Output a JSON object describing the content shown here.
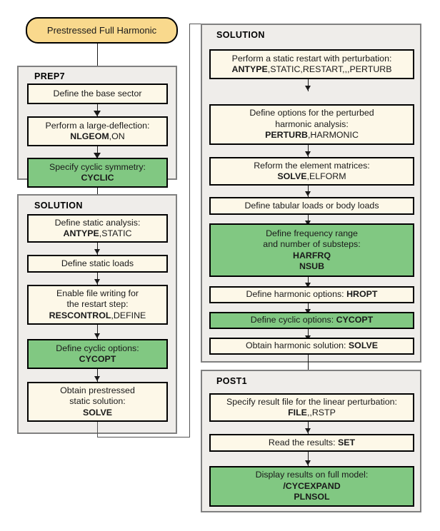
{
  "diagram": {
    "title": "Prestressed Full Harmonic",
    "colors": {
      "start_fill": "#f9d98d",
      "node_fill": "#fdf8e8",
      "highlight_fill": "#81c882",
      "group_fill": "#efedea",
      "group_border": "#808080",
      "node_border": "#000000",
      "connector": "#1a1a1a"
    },
    "start": {
      "label": "Prestressed Full Harmonic"
    },
    "groups": [
      {
        "id": "prep7",
        "title": "PREP7",
        "nodes": [
          {
            "id": "define-base-sector",
            "line1": "Define the base sector",
            "line1_bold": "",
            "line1_tail": "",
            "highlight": false
          },
          {
            "id": "nlgeom",
            "line1": "Perform a large-deflection:",
            "line2_bold": "NLGEOM",
            "line2_tail": ",ON",
            "highlight": false
          },
          {
            "id": "cyclic",
            "line1": "Specify cyclic symmetry:",
            "line2_bold": "CYCLIC",
            "line2_tail": "",
            "highlight": true
          }
        ]
      },
      {
        "id": "solution-left",
        "title": "SOLUTION",
        "nodes": [
          {
            "id": "antype-static",
            "line1": "Define static analysis:",
            "line2_bold": "ANTYPE",
            "line2_tail": ",STATIC",
            "highlight": false
          },
          {
            "id": "define-static-loads",
            "line1": "Define static loads",
            "highlight": false
          },
          {
            "id": "rescontrol",
            "line1": "Enable file writing for",
            "line2": "the restart step:",
            "line3_bold": "RESCONTROL",
            "line3_tail": ",DEFINE",
            "highlight": false
          },
          {
            "id": "cycopt-left",
            "line1": "Define cyclic options:",
            "line2_bold": "CYCOPT",
            "line2_tail": "",
            "highlight": true
          },
          {
            "id": "solve-static",
            "line1": "Obtain prestressed",
            "line2": "static solution:",
            "line3_bold": "SOLVE",
            "line3_tail": "",
            "highlight": false
          }
        ]
      },
      {
        "id": "solution-right",
        "title": "SOLUTION",
        "nodes": [
          {
            "id": "antype-restart-perturb",
            "line1": "Perform a static restart with perturbation:",
            "line2_bold": "ANTYPE",
            "line2_tail": ",STATIC,RESTART,,,PERTURB",
            "highlight": false
          },
          {
            "id": "perturb-harmonic",
            "line1": "Define options for the perturbed",
            "line2": "harmonic analysis:",
            "line3_bold": "PERTURB",
            "line3_tail": ",HARMONIC",
            "highlight": false
          },
          {
            "id": "solve-elform",
            "line1": "Reform the element matrices:",
            "line2_bold": "SOLVE",
            "line2_tail": ",ELFORM",
            "highlight": false
          },
          {
            "id": "tabular-loads",
            "line1": "Define tabular loads or body loads",
            "highlight": false
          },
          {
            "id": "harfrq-nsub",
            "line1": "Define frequency range",
            "line2": "and number of substeps:",
            "line3_bold": "HARFRQ",
            "line4_bold": "NSUB",
            "highlight": true
          },
          {
            "id": "hropt",
            "inline_prefix": "Define harmonic options: ",
            "inline_bold": "HROPT",
            "highlight": false
          },
          {
            "id": "cycopt-right",
            "inline_prefix": "Define cyclic options: ",
            "inline_bold": "CYCOPT",
            "highlight": true
          },
          {
            "id": "solve-harmonic",
            "inline_prefix": "Obtain harmonic solution: ",
            "inline_bold": "SOLVE",
            "highlight": false
          }
        ]
      },
      {
        "id": "post1",
        "title": "POST1",
        "nodes": [
          {
            "id": "file-rstp",
            "line1": "Specify result file for the linear perturbation:",
            "line2_bold": "FILE",
            "line2_tail": ",,RSTP",
            "highlight": false
          },
          {
            "id": "set",
            "inline_prefix": "Read the results: ",
            "inline_bold": "SET",
            "highlight": false
          },
          {
            "id": "cycexpand-plnsol",
            "line1": "Display results on full model:",
            "line3_bold": "/CYCEXPAND",
            "line4_bold": "PLNSOL",
            "highlight": true
          }
        ]
      }
    ]
  }
}
